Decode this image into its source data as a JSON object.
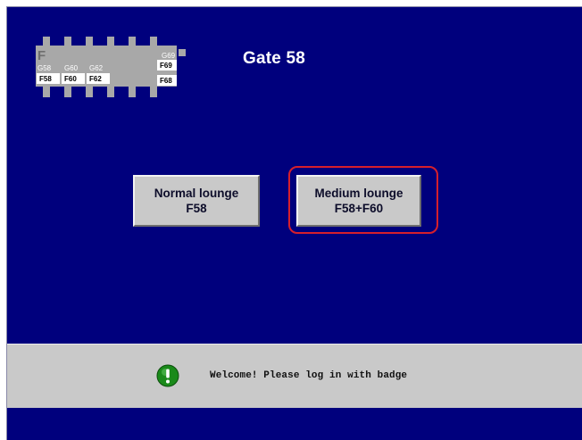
{
  "header": {
    "title": "Gate 58"
  },
  "gate_map": {
    "label_letter": "F",
    "top_labels": [
      "G58",
      "G60",
      "G62",
      "G69"
    ],
    "boxed_labels": [
      "F58",
      "F60",
      "F62",
      "F69",
      "F68"
    ],
    "colors": {
      "body": "#a8a8a8",
      "box_fill": "#ffffff",
      "label_text": "#ffffff",
      "box_text": "#000000"
    }
  },
  "buttons": {
    "normal_lounge": {
      "line1": "Normal lounge",
      "line2": "F58"
    },
    "medium_lounge": {
      "line1": "Medium lounge",
      "line2": "F58+F60"
    }
  },
  "status": {
    "icon": "exclamation-icon",
    "message": "Welcome! Please log in with badge",
    "icon_color": "#1a8a1a"
  },
  "colors": {
    "background": "#00007d",
    "highlight": "#d61f2c",
    "panel": "#c9c9c9"
  }
}
